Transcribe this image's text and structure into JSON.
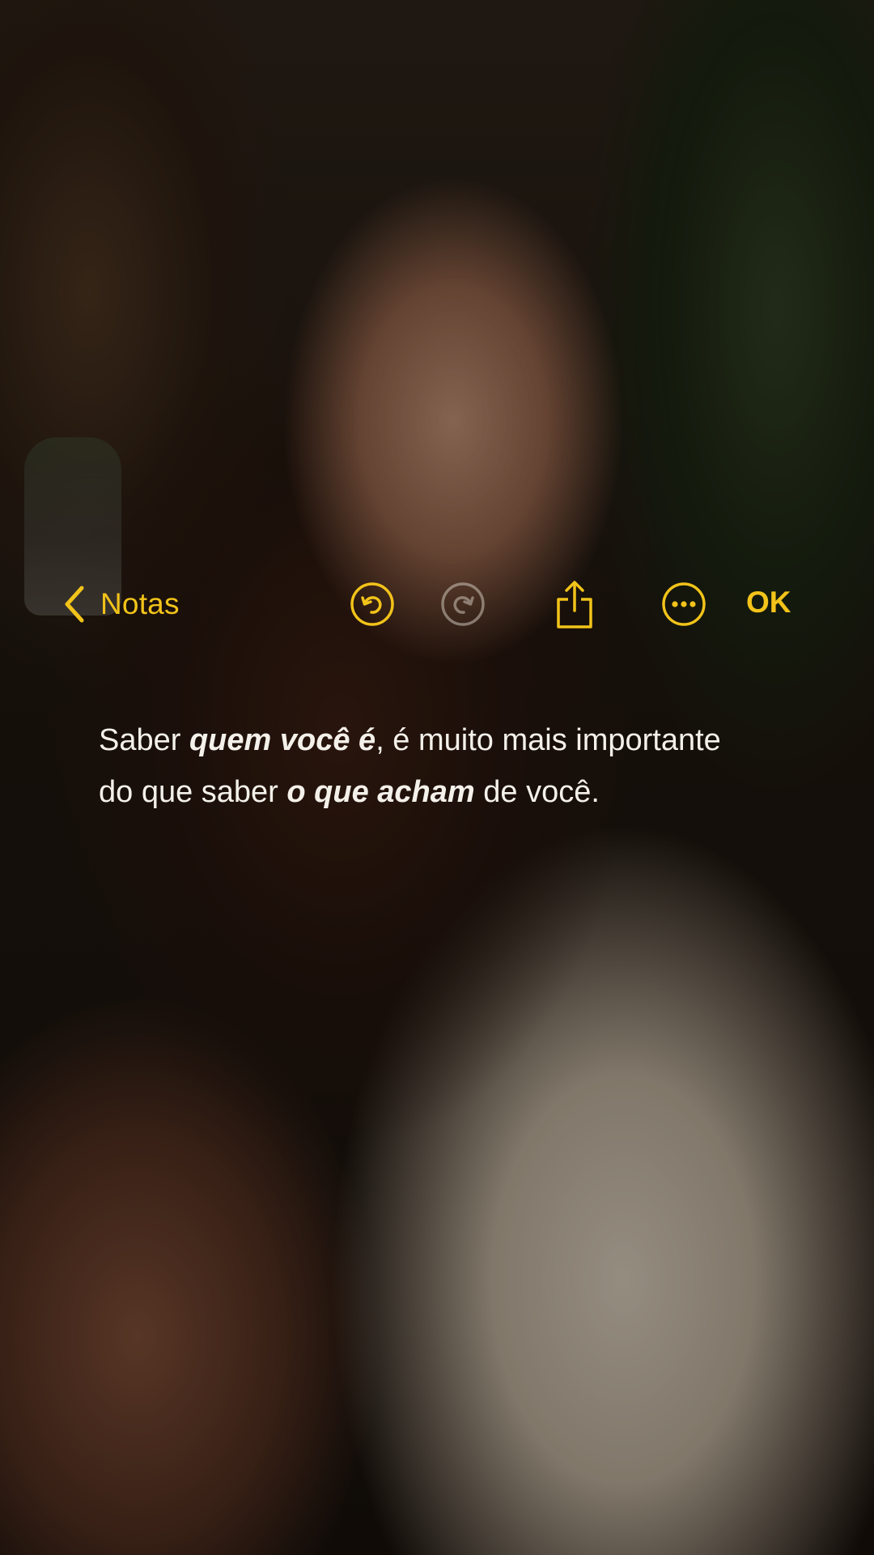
{
  "toolbar": {
    "back_label": "Notas",
    "back_icon": "chevron-left-icon",
    "undo_icon": "undo-icon",
    "redo_icon": "redo-icon",
    "share_icon": "share-icon",
    "more_icon": "more-icon",
    "done_label": "OK",
    "accent_color": "#f2c31a"
  },
  "note": {
    "segments": [
      "Saber ",
      "quem você é",
      ", é muito mais importante do que saber ",
      "o que acham",
      " de você."
    ],
    "text_color": "#f4f0ea"
  },
  "background": {
    "description_icon": "photo-background"
  }
}
